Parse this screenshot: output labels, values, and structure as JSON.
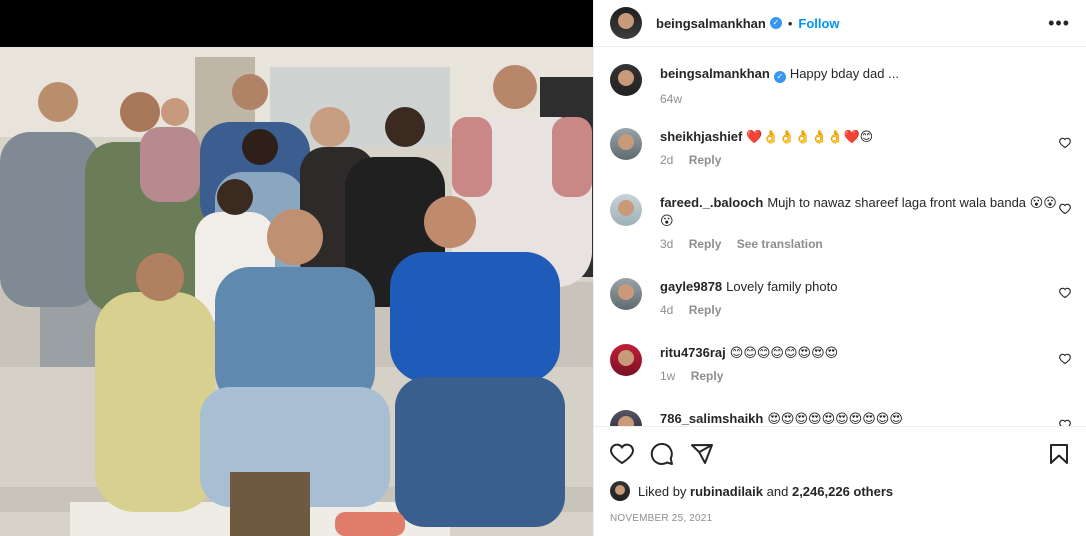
{
  "post": {
    "author": "beingsalmankhan",
    "follow_label": "Follow",
    "separator": "•",
    "caption_author": "beingsalmankhan",
    "caption": "Happy bday dad ...",
    "caption_time": "64w"
  },
  "comments": [
    {
      "user": "sheikhjashief",
      "text": "❤️👌👌👌👌👌❤️😊",
      "time": "2d",
      "reply": "Reply",
      "translate": ""
    },
    {
      "user": "fareed._.balooch",
      "text": "Mujh to nawaz shareef laga front wala banda 😮😮😮",
      "time": "3d",
      "reply": "Reply",
      "translate": "See translation"
    },
    {
      "user": "gayle9878",
      "text": "Lovely family photo",
      "time": "4d",
      "reply": "Reply",
      "translate": ""
    },
    {
      "user": "ritu4736raj",
      "text": "😊😊😊😊😊😍😍😍",
      "time": "1w",
      "reply": "Reply",
      "translate": ""
    },
    {
      "user": "786_salimshaikh",
      "text": "😍😍😍😍😍😍😍😍😍😍",
      "time": "",
      "reply": "",
      "translate": ""
    }
  ],
  "likes": {
    "prefix": "Liked by",
    "user": "rubinadilaik",
    "and": "and",
    "count": "2,246,226 others"
  },
  "date": "NOVEMBER 25, 2021",
  "icons": {
    "more": "more-options-icon",
    "like": "heart-icon",
    "comment": "comment-icon",
    "share": "share-icon",
    "save": "bookmark-icon",
    "verified": "verified-badge-icon"
  },
  "colors": {
    "accent": "#0095f6",
    "verified": "#3897f0",
    "muted": "#8e8e8e",
    "text": "#262626"
  }
}
